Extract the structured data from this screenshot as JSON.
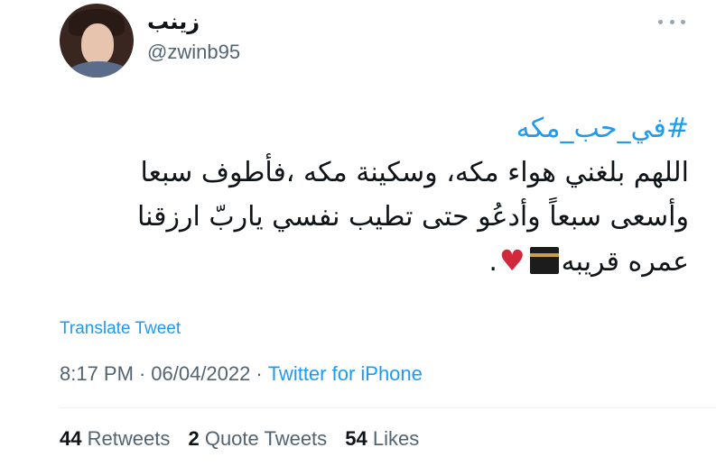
{
  "tweet": {
    "author": {
      "display_name": "زينب",
      "handle": "@zwinb95"
    },
    "more_icon": "ellipsis-icon",
    "body": {
      "hashtag": "#في_حب_مكه",
      "line1": "اللهم بلغني هواء مكه، وسكينة مكه ،فأطوف سبعا",
      "line2": "وأسعى سبعاً وأدعُو حتى تطيب نفسي ياربّ ارزقنا",
      "line3_text": "عمره قريبه",
      "line3_end": ".",
      "emoji": [
        "kaaba-icon",
        "red-heart-icon"
      ]
    },
    "translate_label": "Translate Tweet",
    "time": "8:17 PM",
    "date": "06/04/2022",
    "separator": "·",
    "source": "Twitter for iPhone",
    "stats": {
      "retweets_count": "44",
      "retweets_label": "Retweets",
      "quotes_count": "2",
      "quotes_label": "Quote Tweets",
      "likes_count": "54",
      "likes_label": "Likes"
    },
    "colors": {
      "accent": "#1d9bf0",
      "secondary_text": "#536471",
      "heart": "#d2283c"
    }
  }
}
